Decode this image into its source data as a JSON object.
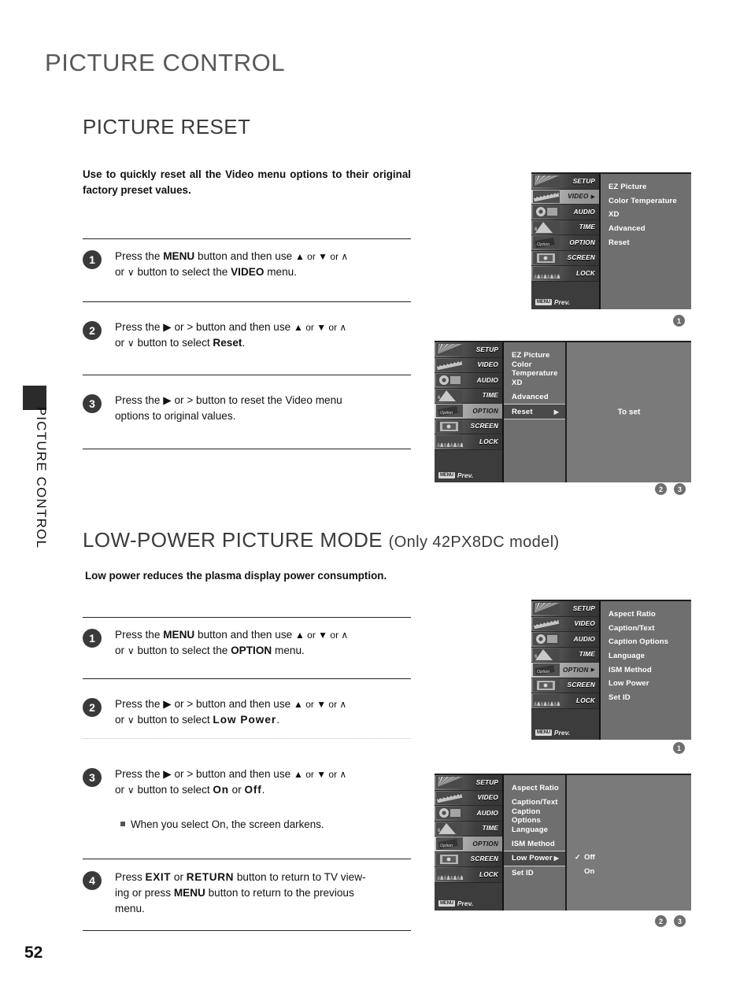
{
  "page": {
    "title": "PICTURE CONTROL",
    "side_tab": "PICTURE CONTROL",
    "number": "52"
  },
  "sections": [
    {
      "heading": "PICTURE RESET",
      "heading_suffix": "",
      "lede": "Use to quickly reset all the Video menu options to their original factory preset values."
    },
    {
      "heading": "LOW-POWER PICTURE MODE",
      "heading_suffix": "(Only 42PX8DC model)",
      "lede": "Low power reduces the plasma display power consumption."
    }
  ],
  "reset_steps": [
    {
      "num": "1",
      "line1_a": "Press the ",
      "line1_b": "MENU",
      "line1_c": " button and then use ",
      "line1_glyphs": "▲ or ▼  or  ∧",
      "line2_a": "or ",
      "line2_glyph": "∨",
      "line2_b": "  button to select the ",
      "line2_c": "VIDEO",
      "line2_d": " menu."
    },
    {
      "num": "2",
      "line1_a": "Press the ",
      "line1_b": "▶",
      "line1_c": " or ",
      "line1_d": ">",
      "line1_e": "  button and then use ",
      "line1_glyphs": "▲ or ▼  or  ∧",
      "line2_a": "or ",
      "line2_glyph": "∨",
      "line2_b": "  button to select ",
      "line2_c": "Reset",
      "line2_d": "."
    },
    {
      "num": "3",
      "line1_a": "Press the ",
      "line1_b": "▶",
      "line1_c": "  or  ",
      "line1_d": ">",
      "line1_e": "   button to reset the Video menu",
      "line2_a": "options to original values."
    }
  ],
  "lowpower_steps": [
    {
      "num": "1",
      "line1_a": "Press the ",
      "line1_b": "MENU",
      "line1_c": " button and then use ",
      "line1_glyphs": "▲ or ▼  or  ∧",
      "line2_a": "or ",
      "line2_glyph": "∨",
      "line2_b": "  button to select the ",
      "line2_c": "OPTION",
      "line2_d": " menu."
    },
    {
      "num": "2",
      "line1_a": "Press the ",
      "line1_b": "▶",
      "line1_c": " or ",
      "line1_d": ">",
      "line1_e": "  button and then use ",
      "line1_glyphs": "▲ or ▼  or  ∧",
      "line2_a": "or ",
      "line2_glyph": "∨",
      "line2_b": "  button to select ",
      "line2_c": "Low Power",
      "line2_d": "."
    },
    {
      "num": "3",
      "line1_a": "Press the ",
      "line1_b": "▶",
      "line1_c": " or ",
      "line1_d": ">",
      "line1_e": "  button and then use ",
      "line1_glyphs": "▲ or ▼  or  ∧",
      "line2_a": "or ",
      "line2_glyph": "∨",
      "line2_b": "  button to select ",
      "line2_c": "On",
      "line2_d": " or ",
      "line2_e": "Off",
      "line2_f": "."
    },
    {
      "num": "4",
      "line1_a": "Press ",
      "line1_b": "EXIT",
      "line1_c": " or ",
      "line1_d": "RETURN",
      "line1_e": " button to return to TV view-",
      "line2_a": "ing or press ",
      "line2_b": "MENU",
      "line2_c": " button to return to the previous",
      "line3_a": "menu."
    }
  ],
  "note": "When you select On, the screen darkens.",
  "osd": {
    "sidebar_items": [
      {
        "label": "SETUP",
        "icon": "setup-icon"
      },
      {
        "label": "VIDEO",
        "icon": "video-icon"
      },
      {
        "label": "AUDIO",
        "icon": "audio-icon"
      },
      {
        "label": "TIME",
        "icon": "time-icon"
      },
      {
        "label": "OPTION",
        "icon": "option-icon"
      },
      {
        "label": "SCREEN",
        "icon": "screen-icon"
      },
      {
        "label": "LOCK",
        "icon": "lock-icon"
      }
    ],
    "prev_key": "MENU",
    "prev_label": "Prev."
  },
  "panels": [
    {
      "id": "video-menu-panel",
      "selected_sidebar": "VIDEO",
      "selected_has_arrow": true,
      "items": [
        "EZ Picture",
        "Color Temperature",
        "XD",
        "Advanced",
        "Reset"
      ],
      "highlight_index": -1,
      "detail": null,
      "markers": [
        "1"
      ]
    },
    {
      "id": "video-reset-panel",
      "selected_sidebar": "OPTION",
      "selected_has_arrow": false,
      "items": [
        "EZ Picture",
        "Color Temperature",
        "XD",
        "Advanced",
        "Reset"
      ],
      "highlight_index": 4,
      "highlight_arrow": "▶",
      "detail": {
        "type": "text",
        "text": "To set"
      },
      "markers": [
        "2",
        "3"
      ]
    },
    {
      "id": "option-menu-panel",
      "selected_sidebar": "OPTION",
      "selected_has_arrow": true,
      "items": [
        "Aspect Ratio",
        "Caption/Text",
        "Caption Options",
        "Language",
        "ISM Method",
        "Low Power",
        "Set ID"
      ],
      "highlight_index": -1,
      "detail": null,
      "markers": [
        "1"
      ]
    },
    {
      "id": "low-power-panel",
      "selected_sidebar": "OPTION",
      "selected_has_arrow": false,
      "items": [
        "Aspect Ratio",
        "Caption/Text",
        "Caption Options",
        "Language",
        "ISM Method",
        "Low Power",
        "Set ID"
      ],
      "highlight_index": 5,
      "highlight_arrow": "▶",
      "detail": {
        "type": "options",
        "options": [
          {
            "label": "Off",
            "checked": true,
            "check": "✓"
          },
          {
            "label": "On",
            "checked": false,
            "check": ""
          }
        ]
      },
      "markers": [
        "2",
        "3"
      ]
    }
  ]
}
